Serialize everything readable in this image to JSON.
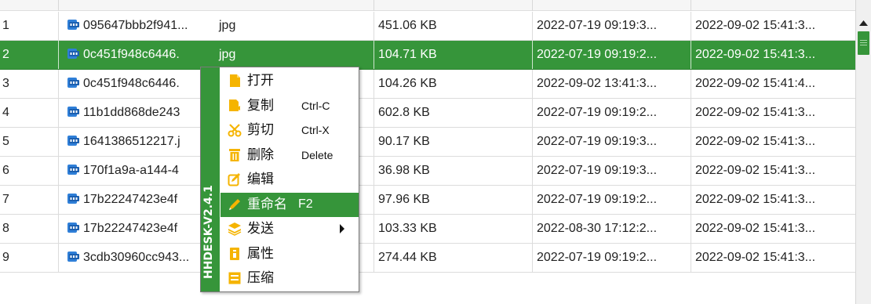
{
  "colors": {
    "accent": "#36953a",
    "icon_orange": "#f5b400",
    "icon_file": "#2f7fd8"
  },
  "file_list": {
    "rows": [
      {
        "index": "1",
        "name": "095647bbb2f941...",
        "type": "jpg",
        "size": "451.06 KB",
        "created": "2022-07-19 09:19:3...",
        "modified": "2022-09-02 15:41:3...",
        "selected": false
      },
      {
        "index": "2",
        "name": "0c451f948c6446.",
        "type": "jpg",
        "size": "104.71 KB",
        "created": "2022-07-19 09:19:2...",
        "modified": "2022-09-02 15:41:3...",
        "selected": true
      },
      {
        "index": "3",
        "name": "0c451f948c6446.",
        "type": "",
        "size": "104.26 KB",
        "created": "2022-09-02 13:41:3...",
        "modified": "2022-09-02 15:41:4...",
        "selected": false
      },
      {
        "index": "4",
        "name": "11b1dd868de243",
        "type": "",
        "size": "602.8 KB",
        "created": "2022-07-19 09:19:2...",
        "modified": "2022-09-02 15:41:3...",
        "selected": false
      },
      {
        "index": "5",
        "name": "1641386512217.j",
        "type": "",
        "size": "90.17 KB",
        "created": "2022-07-19 09:19:3...",
        "modified": "2022-09-02 15:41:3...",
        "selected": false
      },
      {
        "index": "6",
        "name": "170f1a9a-a144-4",
        "type": "",
        "size": "36.98 KB",
        "created": "2022-07-19 09:19:3...",
        "modified": "2022-09-02 15:41:3...",
        "selected": false
      },
      {
        "index": "7",
        "name": "17b22247423e4f",
        "type": "",
        "size": "97.96 KB",
        "created": "2022-07-19 09:19:2...",
        "modified": "2022-09-02 15:41:3...",
        "selected": false
      },
      {
        "index": "8",
        "name": "17b22247423e4f",
        "type": "",
        "size": "103.33 KB",
        "created": "2022-08-30 17:12:2...",
        "modified": "2022-09-02 15:41:3...",
        "selected": false
      },
      {
        "index": "9",
        "name": "3cdb30960cc943...",
        "type": "jpg",
        "size": "274.44 KB",
        "created": "2022-07-19 09:19:2...",
        "modified": "2022-09-02 15:41:3...",
        "selected": false
      }
    ]
  },
  "context_menu": {
    "brand": "HHDESK-V2.4.1",
    "items": [
      {
        "label": "打开",
        "shortcut": "",
        "icon": "file-icon"
      },
      {
        "label": "复制",
        "shortcut": "Ctrl-C",
        "icon": "copy-icon"
      },
      {
        "label": "剪切",
        "shortcut": "Ctrl-X",
        "icon": "scissors-icon"
      },
      {
        "label": "删除",
        "shortcut": "Delete",
        "icon": "trash-icon"
      },
      {
        "label": "编辑",
        "shortcut": "",
        "icon": "edit-icon"
      },
      {
        "label": "重命名",
        "shortcut": "F2",
        "icon": "pencil-icon",
        "highlighted": true
      },
      {
        "label": "发送",
        "shortcut": "",
        "icon": "layers-icon",
        "submenu": true
      },
      {
        "label": "属性",
        "shortcut": "",
        "icon": "properties-icon"
      },
      {
        "label": "压缩",
        "shortcut": "",
        "icon": "archive-icon"
      }
    ]
  }
}
